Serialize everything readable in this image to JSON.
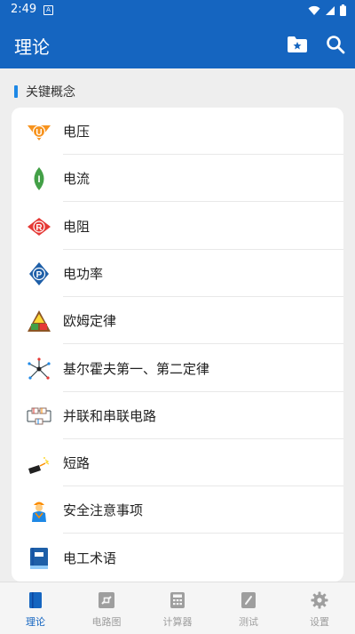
{
  "status_bar": {
    "time": "2:49",
    "notification_glyph": "A"
  },
  "app_bar": {
    "title": "理论",
    "actions": [
      "folder-star-icon",
      "search-icon"
    ]
  },
  "section": {
    "title": "关键概念"
  },
  "items": [
    {
      "label": "电压",
      "icon": "voltage-icon"
    },
    {
      "label": "电流",
      "icon": "current-icon"
    },
    {
      "label": "电阻",
      "icon": "resistance-icon"
    },
    {
      "label": "电功率",
      "icon": "power-icon"
    },
    {
      "label": "欧姆定律",
      "icon": "ohms-law-icon"
    },
    {
      "label": "基尔霍夫第一、第二定律",
      "icon": "kirchhoff-icon"
    },
    {
      "label": "并联和串联电路",
      "icon": "circuit-icon"
    },
    {
      "label": "短路",
      "icon": "short-circuit-icon"
    },
    {
      "label": "安全注意事项",
      "icon": "safety-worker-icon"
    },
    {
      "label": "电工术语",
      "icon": "glossary-book-icon"
    }
  ],
  "icon_letters": {
    "voltage": "U",
    "current": "I",
    "resistance": "R",
    "power": "P"
  },
  "bottom_nav": [
    {
      "label": "理论",
      "icon": "book-icon",
      "active": true
    },
    {
      "label": "电路图",
      "icon": "circuit-diagram-icon",
      "active": false
    },
    {
      "label": "计算器",
      "icon": "calculator-icon",
      "active": false
    },
    {
      "label": "测试",
      "icon": "test-icon",
      "active": false
    },
    {
      "label": "设置",
      "icon": "settings-gear-icon",
      "active": false
    }
  ],
  "colors": {
    "primary": "#1565c0",
    "accent": "#1e88e5",
    "inactive": "#9e9e9e",
    "background": "#eeeeee"
  }
}
